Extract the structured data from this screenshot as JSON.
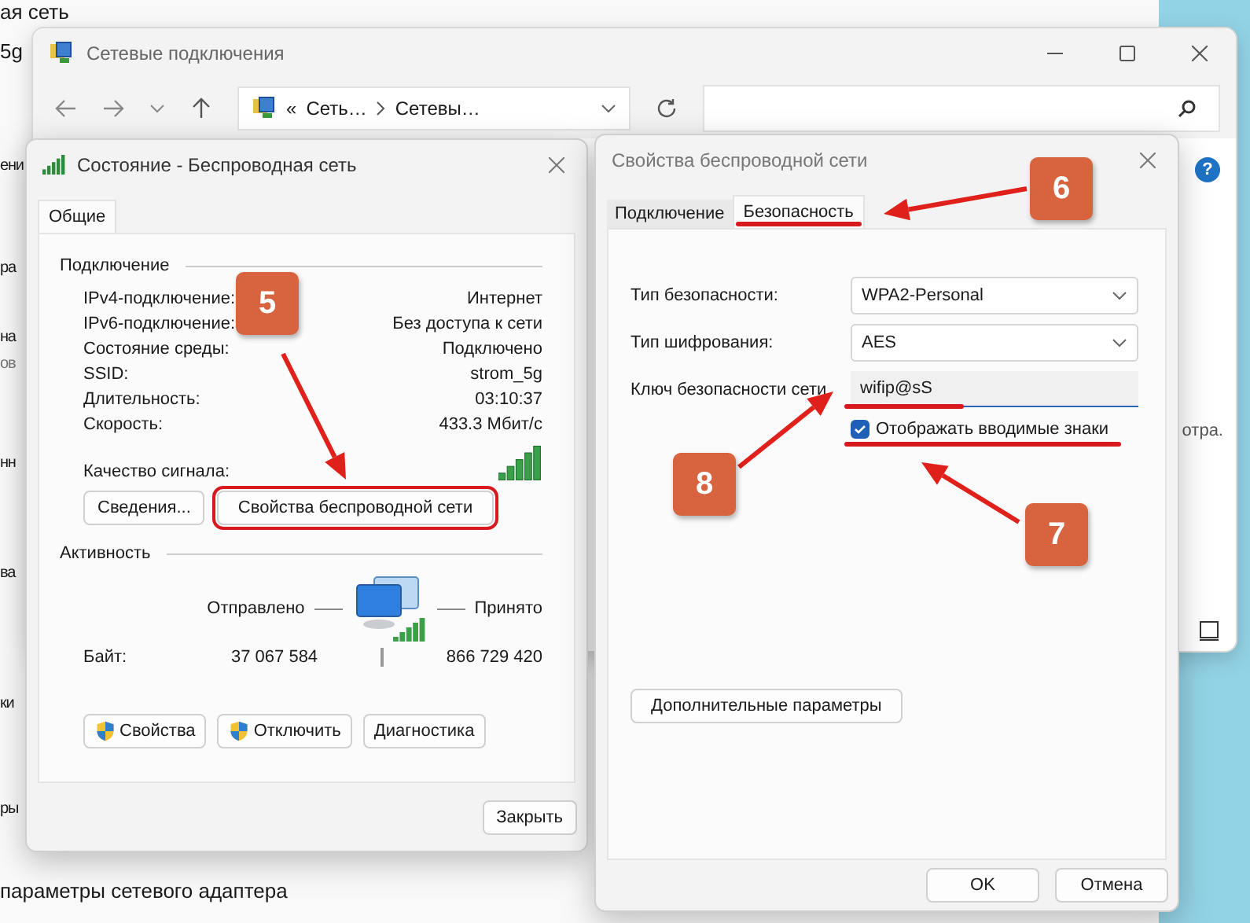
{
  "background": {
    "fragments": [
      "ая сеть",
      "5g",
      "ени",
      "ра",
      "на",
      "ов",
      "нн",
      "ва",
      "ки",
      "ры",
      "параметры сетевого адаптера"
    ]
  },
  "explorer": {
    "title": "Сетевые подключения",
    "breadcrumb_overflow": "«",
    "breadcrumb": [
      "Сеть…",
      "Сетевы…"
    ],
    "help_label": "?",
    "side_text": "отра."
  },
  "status_dialog": {
    "title": "Состояние - Беспроводная сеть",
    "tabs": [
      {
        "label": "Общие",
        "selected": true
      }
    ],
    "connection": {
      "heading": "Подключение",
      "rows": [
        {
          "label": "IPv4-подключение:",
          "value": "Интернет"
        },
        {
          "label": "IPv6-подключение:",
          "value": "Без доступа к сети"
        },
        {
          "label": "Состояние среды:",
          "value": "Подключено"
        },
        {
          "label": "SSID:",
          "value": "strom_5g"
        },
        {
          "label": "Длительность:",
          "value": "03:10:37"
        },
        {
          "label": "Скорость:",
          "value": "433.3 Мбит/с"
        }
      ],
      "signal_label": "Качество сигнала:"
    },
    "buttons": [
      "Сведения...",
      "Свойства беспроводной сети"
    ],
    "activity": {
      "heading": "Активность",
      "sent_label": "Отправлено",
      "received_label": "Принято",
      "bytes_label": "Байт:",
      "bytes_sent": "37 067 584",
      "bytes_received": "866 729 420"
    },
    "action_buttons": [
      {
        "label": "Свойства",
        "shield": true
      },
      {
        "label": "Отключить",
        "shield": true
      },
      {
        "label": "Диагностика",
        "shield": false
      }
    ],
    "close_button": "Закрыть"
  },
  "properties_dialog": {
    "title": "Свойства беспроводной сети",
    "tabs": [
      {
        "label": "Подключение",
        "selected": false
      },
      {
        "label": "Безопасность",
        "selected": true
      }
    ],
    "fields": [
      {
        "kind": "dropdown",
        "label": "Тип безопасности:",
        "value": "WPA2-Personal"
      },
      {
        "kind": "dropdown",
        "label": "Тип шифрования:",
        "value": "AES"
      },
      {
        "kind": "text",
        "label": "Ключ безопасности сети",
        "value": "wifip@sS"
      }
    ],
    "show_characters": {
      "label": "Отображать вводимые знаки",
      "checked": true
    },
    "advanced_button": "Дополнительные параметры",
    "buttons": [
      "OK",
      "Отмена"
    ]
  },
  "annotations": [
    "5",
    "6",
    "8",
    "7"
  ]
}
